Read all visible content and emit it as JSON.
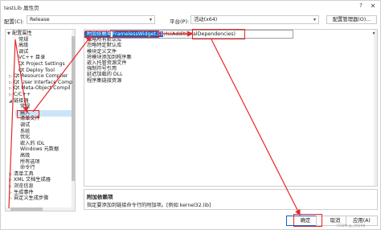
{
  "window": {
    "title": "testLib 属性页",
    "help_label": "?",
    "close_label": "✕"
  },
  "toolbar": {
    "config_label": "配置(C):",
    "config_value": "Release",
    "platform_label": "平台(P):",
    "platform_value": "活动(x64)",
    "config_manager_label": "配置管理器(O)..."
  },
  "tree": {
    "items": [
      {
        "label": "配置属性",
        "expander": "▼"
      },
      {
        "label": "常规",
        "expander": ""
      },
      {
        "label": "高级",
        "expander": ""
      },
      {
        "label": "调试",
        "expander": ""
      },
      {
        "label": "VC++ 目录",
        "expander": ""
      },
      {
        "label": "Qt Project Settings",
        "expander": ""
      },
      {
        "label": "Qt Deploy Tool",
        "expander": ""
      },
      {
        "label": "Qt Resource Compiler",
        "expander": "▷"
      },
      {
        "label": "Qt User Interface Comp",
        "expander": "▷"
      },
      {
        "label": "Qt Meta-Object Compil",
        "expander": "▷"
      },
      {
        "label": "C/C++",
        "expander": "▷"
      },
      {
        "label": "链接器",
        "expander": "◢"
      },
      {
        "label": "常规",
        "expander": ""
      },
      {
        "label": "输入",
        "expander": ""
      },
      {
        "label": "清单文件",
        "expander": ""
      },
      {
        "label": "调试",
        "expander": ""
      },
      {
        "label": "系统",
        "expander": ""
      },
      {
        "label": "优化",
        "expander": ""
      },
      {
        "label": "嵌入的 IDL",
        "expander": ""
      },
      {
        "label": "Windows 元数据",
        "expander": ""
      },
      {
        "label": "高级",
        "expander": ""
      },
      {
        "label": "所有选项",
        "expander": ""
      },
      {
        "label": "命令行",
        "expander": ""
      },
      {
        "label": "清单工具",
        "expander": "▷"
      },
      {
        "label": "XML 文档生成器",
        "expander": "▷"
      },
      {
        "label": "浏览信息",
        "expander": "▷"
      },
      {
        "label": "生成事件",
        "expander": "▷"
      },
      {
        "label": "自定义生成步骤",
        "expander": "▷"
      }
    ]
  },
  "grid": {
    "rows": [
      {
        "name": "附加依赖项"
      },
      {
        "name": "忽略所有默认库"
      },
      {
        "name": "忽略特定默认库"
      },
      {
        "name": "模块定义文件"
      },
      {
        "name": "将模块添加到程序集"
      },
      {
        "name": "嵌入托管资源文件"
      },
      {
        "name": "强制符号引用"
      },
      {
        "name": "延迟加载的 DLL"
      },
      {
        "name": "程序集链接资源"
      }
    ],
    "value_highlight": "FramelessWidget.lib",
    "value_rest": ";%(AdditionalDependencies)",
    "dropdown_icon": "▾"
  },
  "description": {
    "title": "附加依赖项",
    "text": "指定要添加到链接命令行的附加项。[例如 kernel32.lib]"
  },
  "buttons": {
    "ok": "确定",
    "cancel": "取消",
    "apply": "应用(A)"
  },
  "watermark": "CSDN @_26208",
  "colors": {
    "selection": "#0a64c8",
    "tree_selection": "#cce4f7",
    "annotation_red": "#e8262a"
  }
}
